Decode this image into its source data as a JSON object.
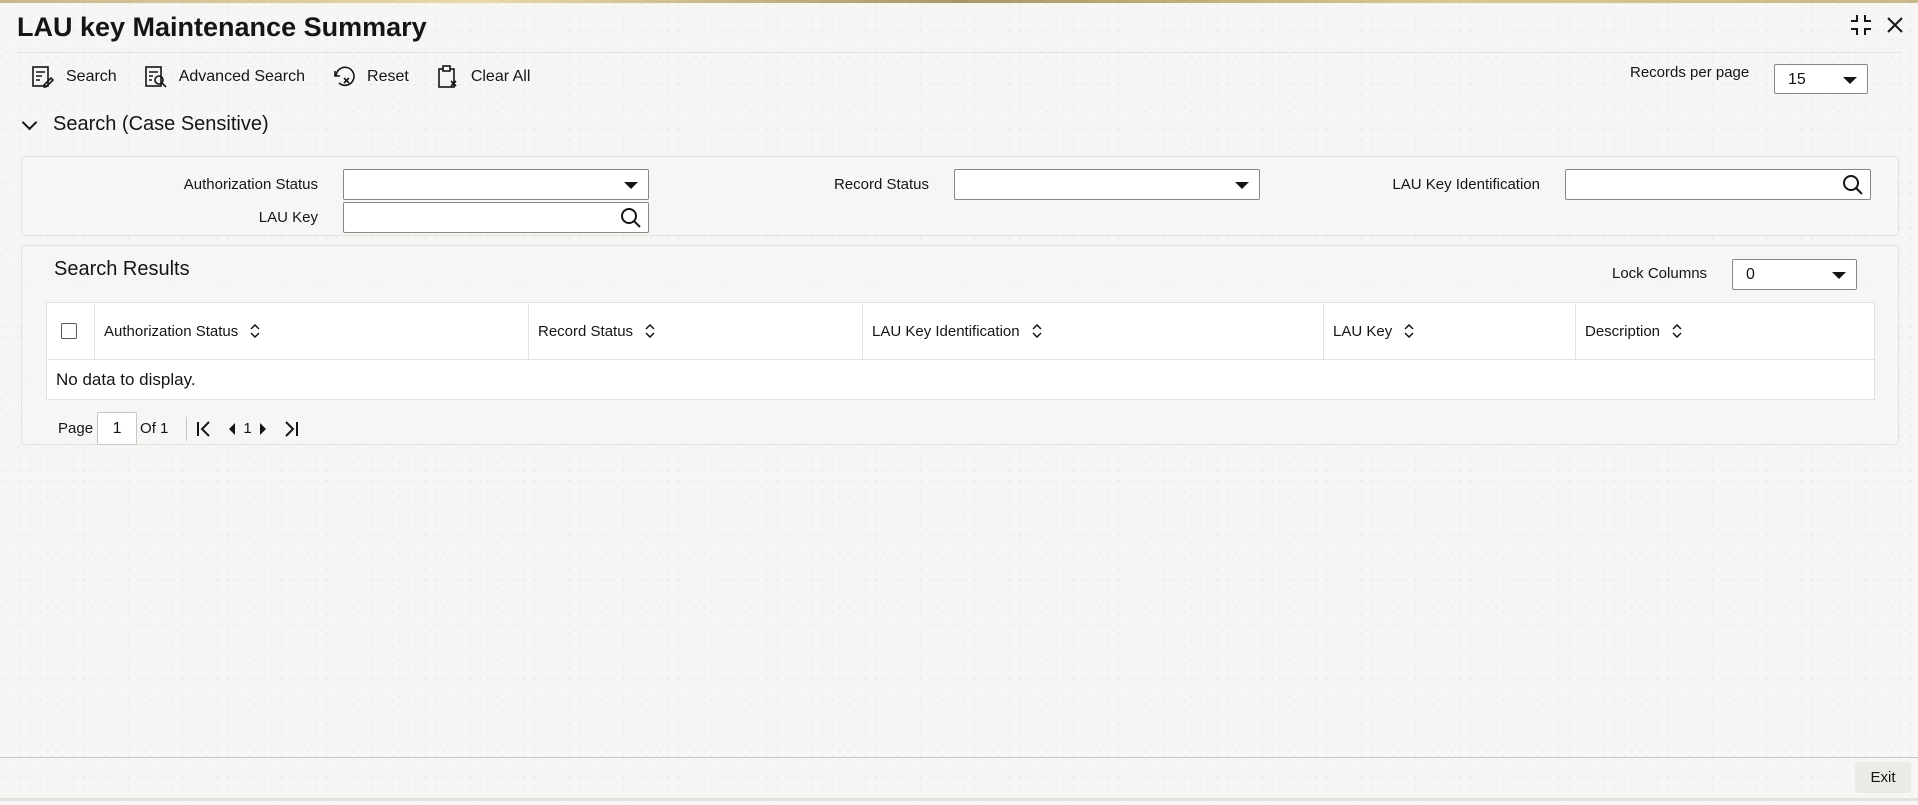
{
  "header": {
    "title": "LAU key Maintenance Summary"
  },
  "toolbar": {
    "search_label": "Search",
    "advanced_search_label": "Advanced Search",
    "reset_label": "Reset",
    "clear_all_label": "Clear All"
  },
  "records_per_page": {
    "label": "Records per page",
    "value": "15"
  },
  "search_section": {
    "title": "Search (Case Sensitive)",
    "fields": {
      "authorization_status_label": "Authorization Status",
      "authorization_status_value": "",
      "record_status_label": "Record Status",
      "record_status_value": "",
      "lau_key_identification_label": "LAU Key Identification",
      "lau_key_identification_value": "",
      "lau_key_label": "LAU Key",
      "lau_key_value": ""
    }
  },
  "results": {
    "title": "Search Results",
    "lock_columns_label": "Lock Columns",
    "lock_columns_value": "0",
    "columns": [
      "Authorization Status",
      "Record Status",
      "LAU Key Identification",
      "LAU Key",
      "Description"
    ],
    "empty_message": "No data to display."
  },
  "pagination": {
    "page_label": "Page",
    "current_page": "1",
    "of_label": "Of 1",
    "page_number": "1"
  },
  "footer": {
    "exit_label": "Exit"
  }
}
